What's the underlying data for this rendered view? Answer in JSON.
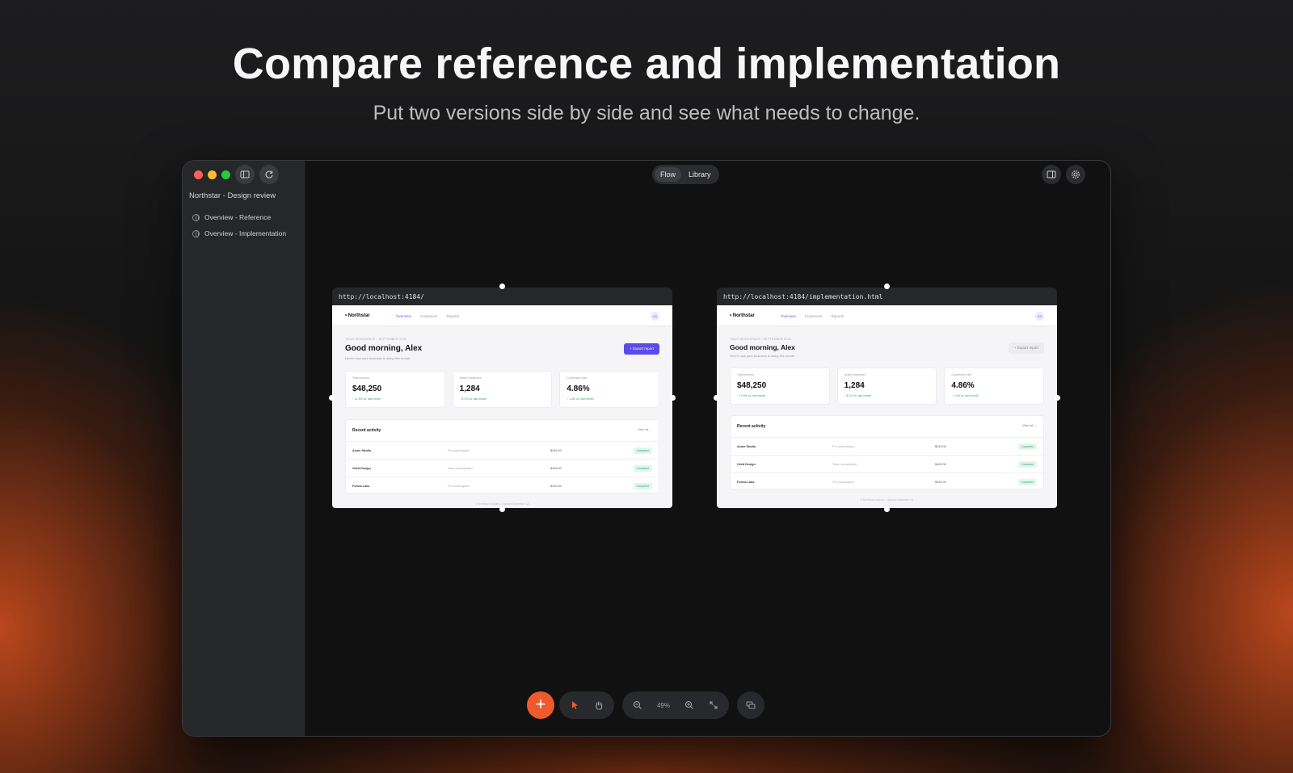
{
  "hero": {
    "title": "Compare reference and implementation",
    "subtitle": "Put two versions side by side and see what needs to change."
  },
  "sidebar": {
    "project_title": "Northstar - Design review",
    "pages": [
      {
        "label": "Overview - Reference"
      },
      {
        "label": "Overview - Implementation"
      }
    ]
  },
  "view_switch": {
    "options": [
      "Flow",
      "Library"
    ],
    "selected": "Flow"
  },
  "frames": [
    {
      "url": "http://localhost:4184/",
      "export_style": "primary",
      "page": {
        "logo": "• Northstar",
        "nav": [
          "Overview",
          "Customers",
          "Reports"
        ],
        "avatar": "AS",
        "eyebrow": "YOUR WORKSPACE / SEPTEMBER 2025",
        "greeting": "Good morning, Alex",
        "greeting_sub": "Here's how your business is doing this month.",
        "export_label": "+ Export report",
        "kpis": [
          {
            "label": "Total revenue",
            "value": "$48,250",
            "delta": "↑ 12.5% vs. last month"
          },
          {
            "label": "Active customers",
            "value": "1,284",
            "delta": "↑ 8.2% vs. last month"
          },
          {
            "label": "Conversion rate",
            "value": "4.86%",
            "delta": "↑ 1.4% vs. last month"
          }
        ],
        "activity_title": "Recent activity",
        "view_all": "View all →",
        "rows": [
          {
            "name": "Acme Studio",
            "plan": "Pro subscription",
            "amount": "$249.00",
            "status": "Completed"
          },
          {
            "name": "Orbit Design",
            "plan": "Team subscription",
            "amount": "$499.00",
            "status": "Completed"
          },
          {
            "name": "Forma Labs",
            "plan": "Pro subscription",
            "amount": "$249.00",
            "status": "Completed"
          }
        ],
        "footer": "© Northstar Analytics · Updated September 18"
      }
    },
    {
      "url": "http://localhost:4184/implementation.html",
      "export_style": "ghost",
      "page": {
        "logo": "• Northstar",
        "nav": [
          "Overview",
          "Customers",
          "Reports"
        ],
        "avatar": "AS",
        "eyebrow": "YOUR WORKSPACE / SEPTEMBER 2025",
        "greeting": "Good morning, Alex",
        "greeting_sub": "Here's how your business is doing this month.",
        "export_label": "+ Export report",
        "kpis": [
          {
            "label": "Total revenue",
            "value": "$48,250",
            "delta": "↑ 12.5% vs. last month"
          },
          {
            "label": "Active customers",
            "value": "1,284",
            "delta": "↑ 8.2% vs. last month"
          },
          {
            "label": "Conversion rate",
            "value": "4.86%",
            "delta": "↑ 1.4% vs. last month"
          }
        ],
        "activity_title": "Recent activity",
        "view_all": "View all →",
        "rows": [
          {
            "name": "Acme Studio",
            "plan": "Pro subscription",
            "amount": "$249.00",
            "status": "Completed"
          },
          {
            "name": "Orbit Design",
            "plan": "Team subscription",
            "amount": "$499.00",
            "status": "Completed"
          },
          {
            "name": "Forma Labs",
            "plan": "Pro subscription",
            "amount": "$249.00",
            "status": "Completed"
          }
        ],
        "footer": "© Northstar Analytics · Updated September 18"
      }
    }
  ],
  "toolbar": {
    "zoom": "49%",
    "add_icon": "plus-icon",
    "tools": [
      "cursor-icon",
      "hand-icon"
    ],
    "zoom_tools": [
      "zoom-out-icon",
      "zoom-in-icon",
      "fit-icon"
    ],
    "extra": "comment-icon"
  },
  "colors": {
    "accent": "#ef5a2b",
    "brand_purple": "#6a5cf0",
    "success": "#2ea86a"
  }
}
